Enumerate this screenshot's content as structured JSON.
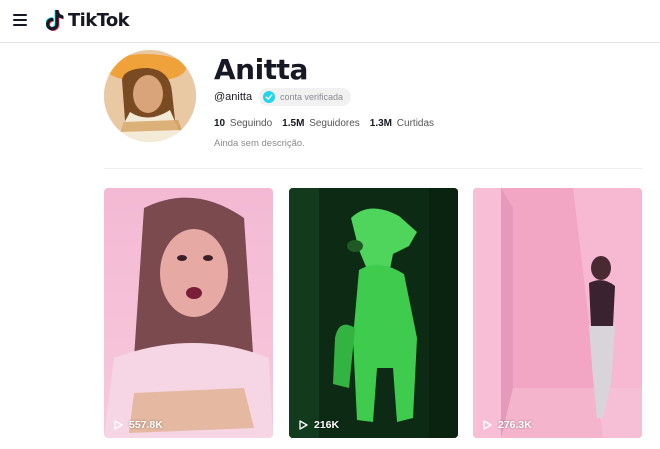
{
  "header": {
    "logo_text": "TikTok"
  },
  "profile": {
    "name": "Anitta",
    "handle": "@anitta",
    "verified_label": "conta verificada",
    "bio": "Ainda sem descrição.",
    "stats": [
      {
        "value": "10",
        "label": "Seguindo"
      },
      {
        "value": "1.5M",
        "label": "Seguidores"
      },
      {
        "value": "1.3M",
        "label": "Curtidas"
      }
    ]
  },
  "videos": [
    {
      "views": "557.8K"
    },
    {
      "views": "216K"
    },
    {
      "views": "276.3K"
    }
  ],
  "colors": {
    "verified": "#20d5ec",
    "text": "#161823",
    "muted": "#8a8b91"
  }
}
